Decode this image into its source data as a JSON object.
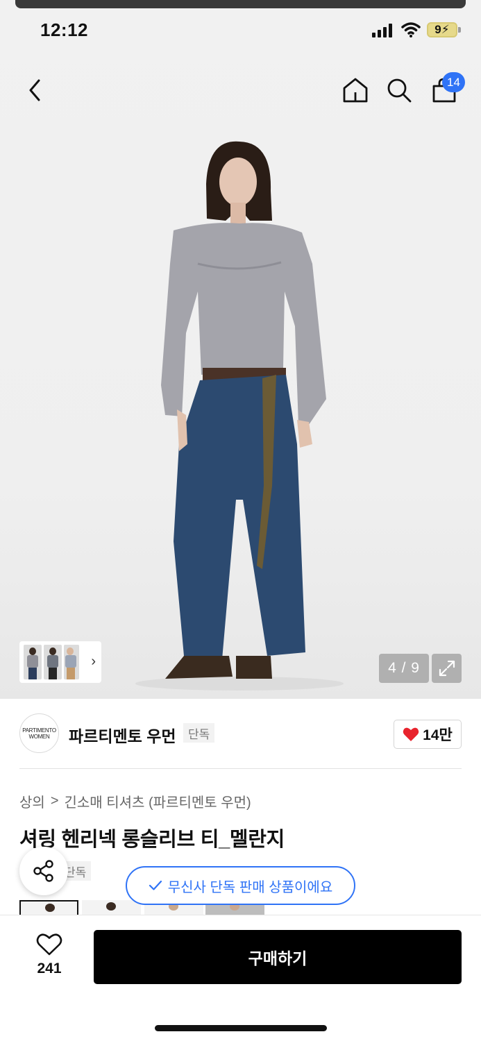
{
  "status_bar": {
    "time": "12:12",
    "battery": "9"
  },
  "header": {
    "cart_count": "14"
  },
  "gallery": {
    "counter": "4 / 9"
  },
  "brand": {
    "logo_line1": "PARTIMENTO",
    "logo_line2": "WOMEN",
    "name": "파르티멘토 우먼",
    "tag": "단독",
    "likes": "14만"
  },
  "breadcrumb": {
    "category": "상의",
    "separator": ">",
    "subcategory": "긴소매 티셔츠 (파르티멘토 우먼)"
  },
  "product": {
    "title": "셔링 헨리넥 롱슬리브 티_멜란지",
    "exclusive_tag": "단독",
    "exclusive_tooltip": "무신사 단독 판매 상품이에요"
  },
  "bottom_bar": {
    "wish_count": "241",
    "buy_label": "구매하기"
  },
  "colors": {
    "accent": "#2f73f6",
    "like": "#e8232d",
    "buy_button": "#000000"
  }
}
